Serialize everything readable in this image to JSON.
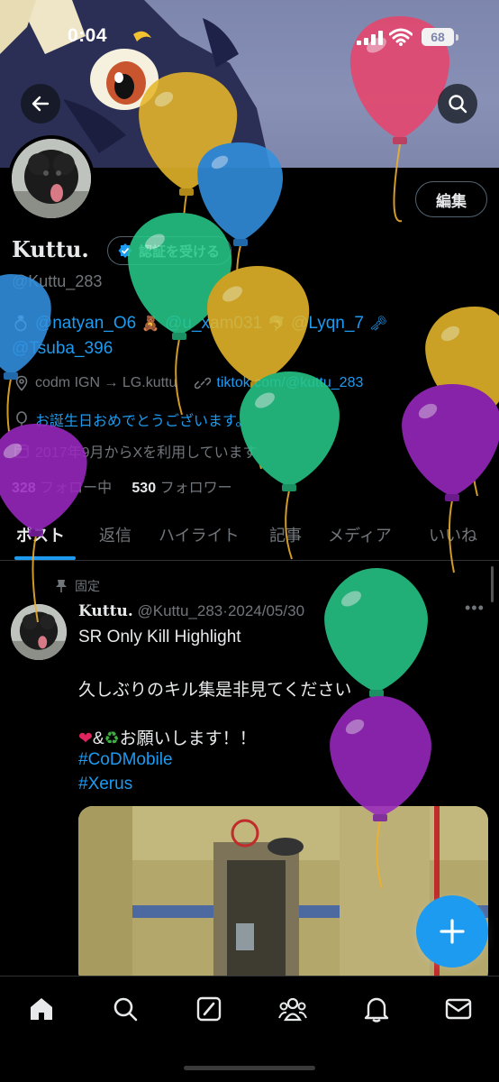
{
  "status_bar": {
    "time": "0:04",
    "battery": "68"
  },
  "profile": {
    "display_name": "Kuttu.",
    "verify_label": "認証を受ける",
    "handle": "@Kuttu_283",
    "edit_label": "編集",
    "bio_line1": [
      "@natyan_O6",
      "@u_xam031",
      "@Lyqn_7"
    ],
    "bio_line2": "@Tsuba_396",
    "game_info": "codm IGN → LG.kuttu",
    "link": "tiktok.com/@kuttu_283",
    "birthday": "お誕生日おめでとうございます。",
    "joined": "2017年9月からXを利用しています",
    "following_count": "328",
    "following_label": "フォロー中",
    "followers_count": "530",
    "followers_label": "フォロワー"
  },
  "tabs": [
    "ポスト",
    "返信",
    "ハイライト",
    "記事",
    "メディア",
    "いいね"
  ],
  "pinned_post": {
    "pinned_label": "固定",
    "author_name": "Kuttu.",
    "author_handle": "@Kuttu_283",
    "separator": "·",
    "date": "2024/05/30",
    "line1": "SR Only Kill Highlight",
    "line2": "久しぶりのキル集是非見てください",
    "line3": "&",
    "line3_tail": "お願いします！！",
    "hashtag1": "#CoDMobile",
    "hashtag2": "#Xerus"
  },
  "icons": {
    "back": "arrow-left-icon",
    "search": "search-icon",
    "compose": "plus-icon",
    "nav": [
      "home-icon",
      "search-icon",
      "grok-icon",
      "communities-icon",
      "bell-icon",
      "mail-icon"
    ]
  },
  "colors": {
    "accent": "#1d9bf0",
    "background": "#000000",
    "muted": "#71767b",
    "text": "#e7e9ea"
  }
}
